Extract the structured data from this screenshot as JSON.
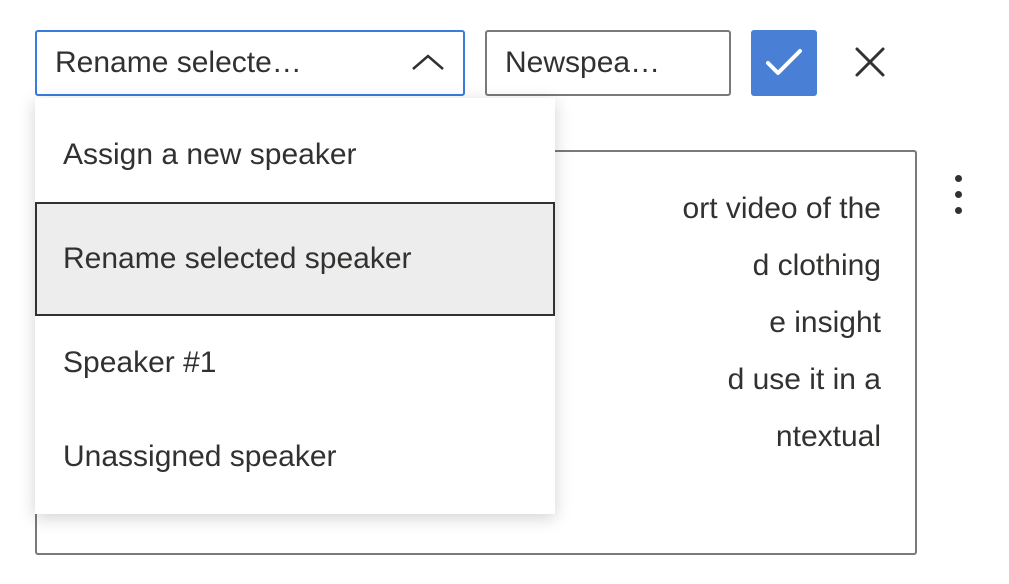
{
  "toolbar": {
    "dropdown": {
      "display": "Rename selecte…",
      "options": [
        {
          "label": "Assign a new speaker",
          "selected": false
        },
        {
          "label": "Rename selected speaker",
          "selected": true
        },
        {
          "label": "Speaker #1",
          "selected": false
        },
        {
          "label": "Unassigned speaker",
          "selected": false
        }
      ]
    },
    "name_input": {
      "value": "Newspea…"
    }
  },
  "content": {
    "lines": [
      "ort video of the",
      "d clothing",
      "e insight",
      "d use it in a",
      "ntextual"
    ]
  }
}
